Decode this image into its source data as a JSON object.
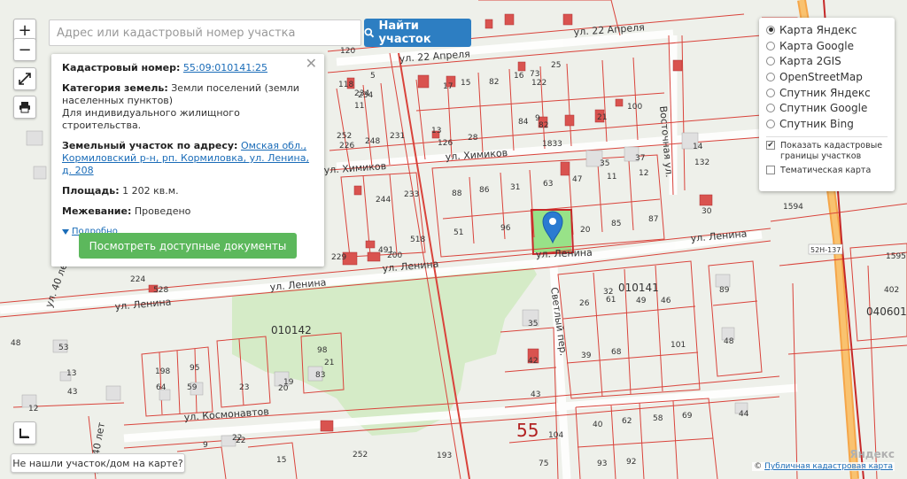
{
  "search": {
    "placeholder": "Адрес или кадастровый номер участка",
    "button_label": "Найти участок"
  },
  "zoom": {
    "in": "+",
    "out": "−"
  },
  "info": {
    "cad_label": "Кадастровый номер:",
    "cad_value": "55:09:010141:25",
    "category_label": "Категория земель:",
    "category_value": "Земли поселений (земли населенных пунктов)",
    "use_value": "Для индивидуального жилищного строительства.",
    "address_label": "Земельный участок по адресу:",
    "address_value": "Омская обл., Кормиловский р-н, рп. Кормиловка, ул. Ленина, д. 208",
    "area_label": "Площадь:",
    "area_value": "1 202 кв.м.",
    "survey_label": "Межевание:",
    "survey_value": "Проведено",
    "more": "Подробно",
    "docs_button": "Посмотреть доступные документы",
    "close": "✕"
  },
  "layers": {
    "maps": [
      {
        "label": "Карта Яндекс",
        "selected": true
      },
      {
        "label": "Карта Google",
        "selected": false
      },
      {
        "label": "Карта 2GIS",
        "selected": false
      },
      {
        "label": "OpenStreetMap",
        "selected": false
      },
      {
        "label": "Спутник Яндекс",
        "selected": false
      },
      {
        "label": "Спутник Google",
        "selected": false
      },
      {
        "label": "Спутник Bing",
        "selected": false
      }
    ],
    "show_borders": "Показать кадастровые границы участков",
    "show_borders_checked": true,
    "thematic": "Тематическая карта",
    "thematic_checked": false
  },
  "notfound": "Не нашли участок/дом на карте?",
  "attribution": {
    "prefix": "©",
    "link": "Публичная кадастровая карта",
    "watermark": "Яндекс"
  },
  "map": {
    "streets": {
      "s1": "ул. 22 Апреля",
      "s2": "ул. 22 Апреля",
      "s3": "ул. Химиков",
      "s4": "ул. Ленина",
      "s5": "ул. Ленина",
      "s6": "ул. Ленина",
      "s7": "ул. Ленина",
      "s8": "ул. Космонавтов",
      "s9": "Восточная ул.",
      "s10": "Светлый пер.",
      "s11": "ул. 40 лет",
      "s12": "ул. 40 лет",
      "s13": "ул. Химиков"
    },
    "areas": {
      "a1": "010141",
      "a2": "010142",
      "a3": "040601",
      "big55": "55",
      "road": "52Н-137"
    },
    "numbers": [
      "22",
      "234",
      "5",
      "120",
      "118",
      "11",
      "16",
      "122",
      "25",
      "17",
      "15",
      "82",
      "88",
      "86",
      "31",
      "63",
      "47",
      "11",
      "12",
      "35",
      "37",
      "14",
      "132",
      "30",
      "51",
      "96",
      "20",
      "85",
      "87",
      "73",
      "234",
      "244",
      "233",
      "248",
      "231",
      "226",
      "252",
      "13",
      "126",
      "28",
      "84",
      "82",
      "9",
      "21",
      "100",
      "1833",
      "229",
      "491",
      "518",
      "200",
      "224",
      "528",
      "61",
      "49",
      "46",
      "26",
      "32",
      "89",
      "48",
      "101",
      "68",
      "43",
      "39",
      "42",
      "35",
      "40",
      "62",
      "58",
      "69",
      "44",
      "93",
      "92",
      "75",
      "104",
      "198",
      "64",
      "95",
      "59",
      "83",
      "21",
      "98",
      "23",
      "19",
      "20",
      "48",
      "53",
      "43",
      "13",
      "12",
      "9",
      "22",
      "15",
      "252",
      "193",
      "1594",
      "402",
      "1595",
      "104"
    ]
  }
}
